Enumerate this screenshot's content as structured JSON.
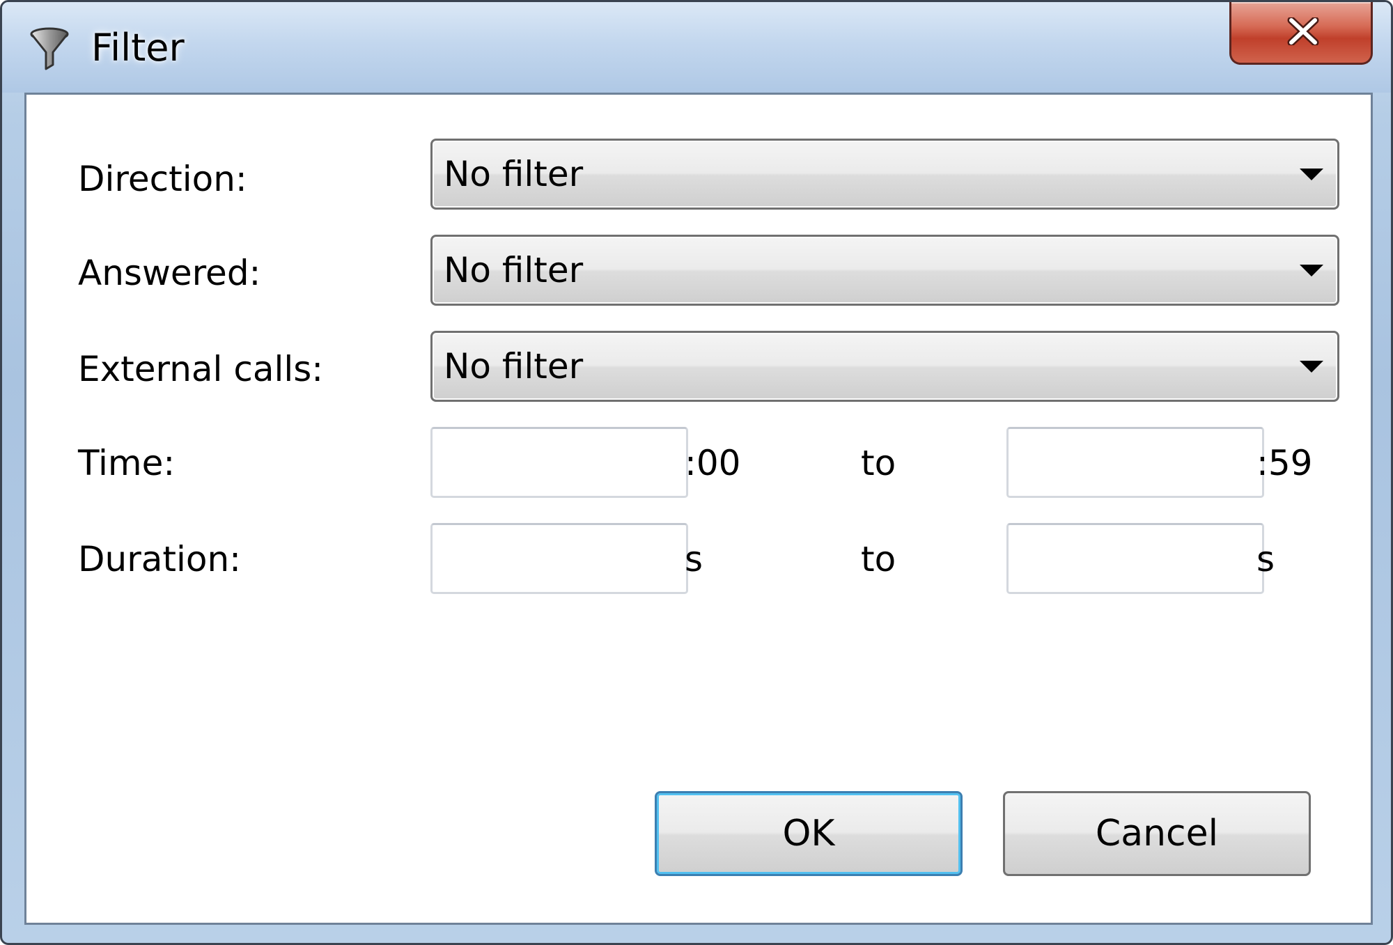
{
  "window": {
    "title": "Filter",
    "icon": "funnel-icon",
    "close_icon": "close-icon"
  },
  "form": {
    "direction": {
      "label": "Direction:",
      "value": "No filter"
    },
    "answered": {
      "label": "Answered:",
      "value": "No filter"
    },
    "external_calls": {
      "label": "External calls:",
      "value": "No filter"
    },
    "time": {
      "label": "Time:",
      "from_value": "",
      "from_suffix": ":00",
      "to_label": "to",
      "to_value": "",
      "to_suffix": ":59"
    },
    "duration": {
      "label": "Duration:",
      "from_value": "",
      "from_suffix": "s",
      "to_label": "to",
      "to_value": "",
      "to_suffix": "s"
    }
  },
  "buttons": {
    "ok_label": "OK",
    "cancel_label": "Cancel"
  },
  "colors": {
    "titlebar": "#c3d7ee",
    "close_button": "#c0402b",
    "default_button_border": "#3c7fb1"
  }
}
